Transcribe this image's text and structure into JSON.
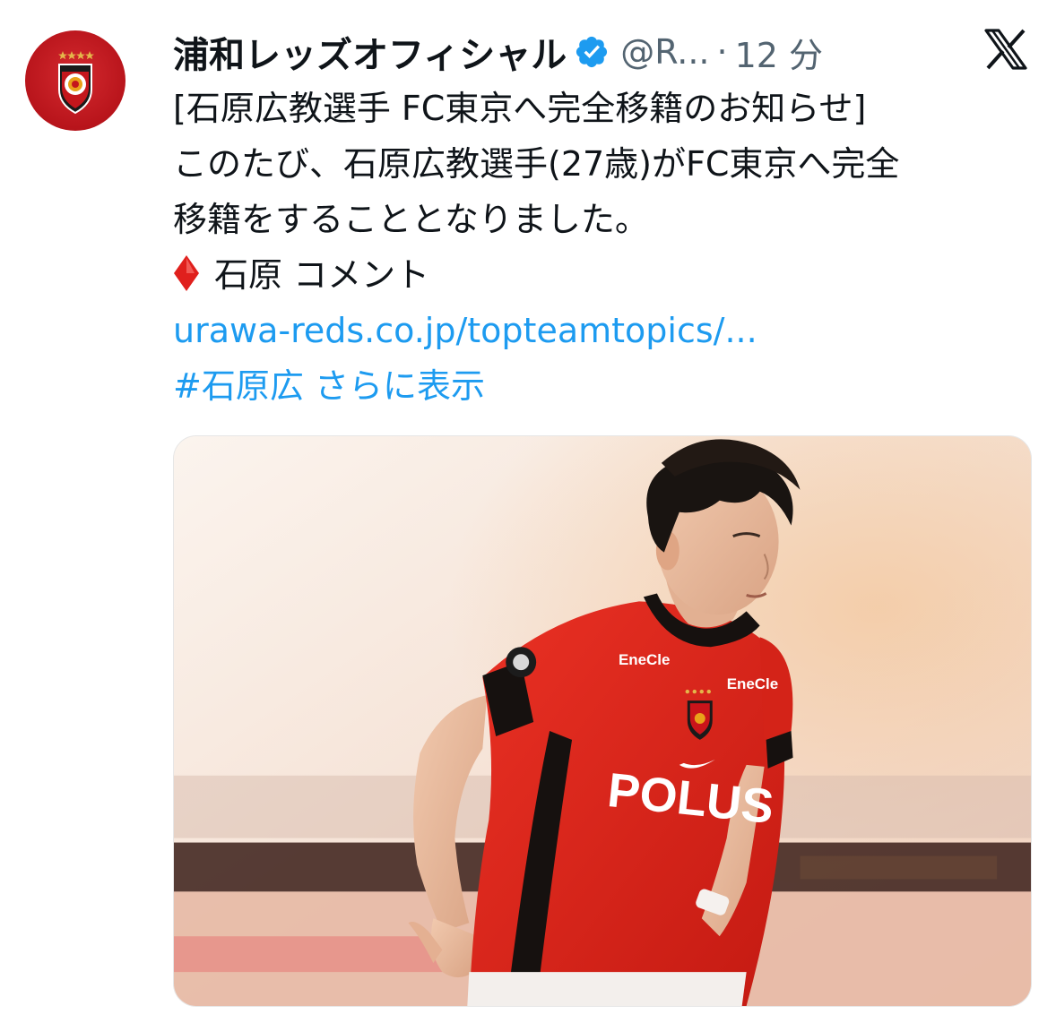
{
  "tweet": {
    "author": {
      "display_name": "浦和レッズオフィシャル",
      "handle": "@R...",
      "time": "12 分",
      "verified": true,
      "avatar_icon": "urawa-reds-crest-icon"
    },
    "separator": "·",
    "platform_icon": "x-logo-icon",
    "lines": {
      "title": "[石原広教選手 FC東京へ完全移籍のお知らせ]",
      "body_1": "このたび、石原広教選手(27歳)がFC東京へ完全",
      "body_2": "移籍をすることとなりました。",
      "comment_label": "石原 コメント",
      "link": "urawa-reds.co.jp/topteamtopics/...",
      "hashtag": "#石原広",
      "show_more": "さらに表示"
    },
    "photo": {
      "subject": "soccer-player-photo",
      "jersey_sponsor": "POLUS",
      "sleeve_sponsor_left": "EneCle",
      "sleeve_sponsor_right": "EneCle"
    }
  },
  "colors": {
    "text": "#0f1419",
    "secondary": "#536471",
    "link": "#1d9bf0",
    "verified": "#1d9bf0",
    "reds": "#d7281e"
  }
}
